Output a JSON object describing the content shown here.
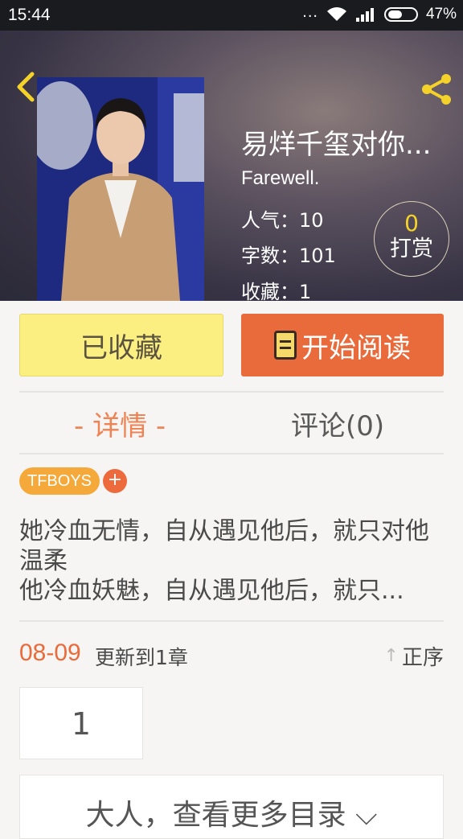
{
  "status_bar": {
    "time": "15:44",
    "dots": "...",
    "battery": "47%"
  },
  "header": {
    "title": "易烊千玺对你...",
    "author": "Farewell.",
    "popularity": "人气：10",
    "word_count": "字数：101",
    "favorites": "收藏：1",
    "tip_count": "0",
    "tip_label": "打赏"
  },
  "actions": {
    "favorited_label": "已收藏",
    "read_label": "开始阅读"
  },
  "tabs": {
    "detail": "- 详情 -",
    "comments": "评论(0)"
  },
  "tags": {
    "items": [
      "TFBOYS"
    ],
    "add": "+"
  },
  "description": {
    "line1": "她冷血无情，自从遇见他后，就只对他温柔",
    "line2": "他冷血妖魅，自从遇见他后，就只..."
  },
  "update": {
    "date": "08-09",
    "text": "更新到1章",
    "sort_label": "正序",
    "sort_arrow": "↑"
  },
  "chapters": {
    "first": "1"
  },
  "more": {
    "label": "大人，查看更多目录 ⌵"
  },
  "colors": {
    "accent": "#e96a3a",
    "favorite_bg": "#fbef82",
    "tag": "#f5a93a",
    "icon": "#f4d22a"
  }
}
